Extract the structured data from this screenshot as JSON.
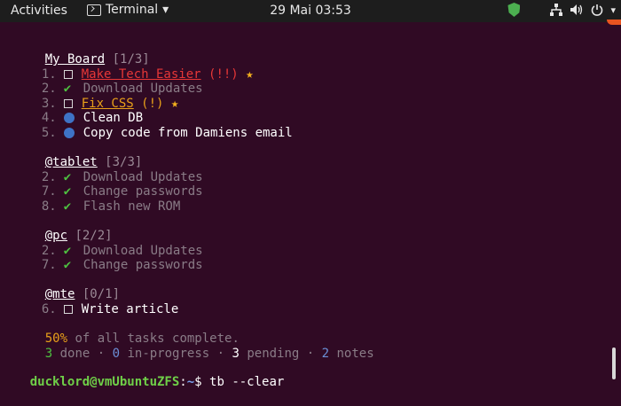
{
  "topbar": {
    "activities": "Activities",
    "app_name": "Terminal",
    "app_menu_arrow": "▾",
    "clock": "29 Mai  03:53",
    "tray": {
      "network": "network-icon",
      "volume": "volume-icon",
      "power": "power-icon"
    }
  },
  "boards": [
    {
      "title": "My Board",
      "count": "[1/3]",
      "items": [
        {
          "num": "1.",
          "status": "pending",
          "text": "Make Tech Easier",
          "priority": "(!!)",
          "priority_level": "high",
          "star": true
        },
        {
          "num": "2.",
          "status": "done",
          "text": "Download Updates"
        },
        {
          "num": "3.",
          "status": "pending",
          "text": "Fix CSS",
          "priority": "(!)",
          "priority_level": "medium",
          "star": true
        },
        {
          "num": "4.",
          "status": "note",
          "text": "Clean DB"
        },
        {
          "num": "5.",
          "status": "note",
          "text": "Copy code from Damiens email"
        }
      ]
    },
    {
      "title": "@tablet",
      "count": "[3/3]",
      "items": [
        {
          "num": "2.",
          "status": "done",
          "text": "Download Updates"
        },
        {
          "num": "7.",
          "status": "done",
          "text": "Change passwords"
        },
        {
          "num": "8.",
          "status": "done",
          "text": "Flash new ROM"
        }
      ]
    },
    {
      "title": "@pc",
      "count": "[2/2]",
      "items": [
        {
          "num": "2.",
          "status": "done",
          "text": "Download Updates"
        },
        {
          "num": "7.",
          "status": "done",
          "text": "Change passwords"
        }
      ]
    },
    {
      "title": "@mte",
      "count": "[0/1]",
      "items": [
        {
          "num": "6.",
          "status": "pending",
          "text": "Write article"
        }
      ]
    }
  ],
  "summary": {
    "percent": "50%",
    "percent_text": " of all tasks complete.",
    "done_count": "3",
    "done_label": " done · ",
    "inprogress_count": "0",
    "inprogress_label": " in-progress · ",
    "pending_count": "3",
    "pending_label": " pending · ",
    "notes_count": "2",
    "notes_label": " notes"
  },
  "prompt": {
    "user_host": "ducklord@vmUbuntuZFS",
    "sep": ":",
    "path": "~",
    "symbol": "$ ",
    "command": "tb --clear"
  },
  "colors": {
    "background": "#300a24",
    "done": "#4ec040",
    "note": "#3e73c6",
    "high": "#e73737",
    "medium": "#e8a019"
  }
}
